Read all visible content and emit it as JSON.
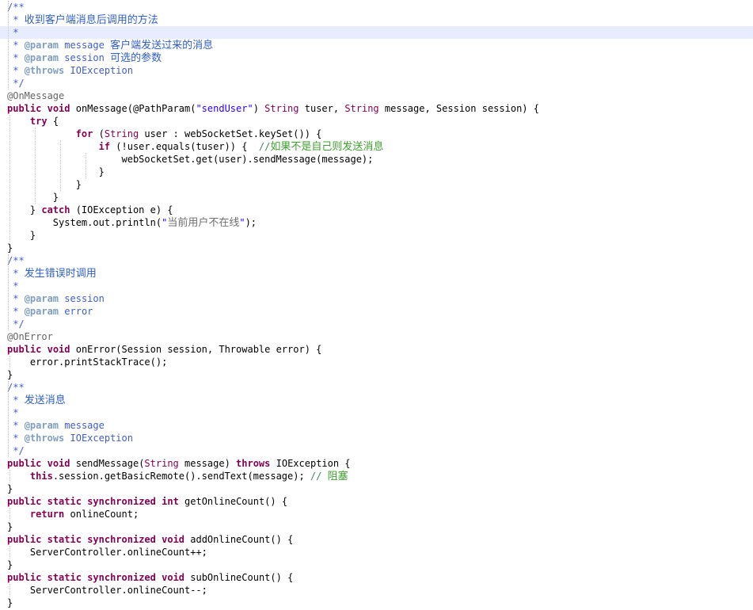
{
  "editor": {
    "lines": [
      [
        {
          "t": "/**",
          "c": "jd"
        }
      ],
      [
        {
          "t": " * ",
          "c": "jd"
        },
        {
          "t": "收到客户端消息后调用的方法",
          "c": "jd",
          "cjk": true
        }
      ],
      [
        {
          "t": " *",
          "c": "jd"
        }
      ],
      [
        {
          "t": " * ",
          "c": "jd"
        },
        {
          "t": "@param",
          "c": "tag"
        },
        {
          "t": " message ",
          "c": "jd"
        },
        {
          "t": "客户端发送过来的消息",
          "c": "jd",
          "cjk": true
        }
      ],
      [
        {
          "t": " * ",
          "c": "jd"
        },
        {
          "t": "@param",
          "c": "tag"
        },
        {
          "t": " session ",
          "c": "jd"
        },
        {
          "t": "可选的参数",
          "c": "jd",
          "cjk": true
        }
      ],
      [
        {
          "t": " * ",
          "c": "jd"
        },
        {
          "t": "@throws",
          "c": "tag"
        },
        {
          "t": " IOException",
          "c": "jd"
        }
      ],
      [
        {
          "t": " */",
          "c": "jd"
        }
      ],
      [
        {
          "t": "@OnMessage",
          "c": "ann"
        }
      ],
      [
        {
          "t": "public",
          "c": "kw"
        },
        {
          "t": " ",
          "c": "pl"
        },
        {
          "t": "void",
          "c": "kw"
        },
        {
          "t": " onMessage(@PathParam(",
          "c": "pl"
        },
        {
          "t": "\"sendUser\"",
          "c": "str"
        },
        {
          "t": ") ",
          "c": "pl"
        },
        {
          "t": "String",
          "c": "ty"
        },
        {
          "t": " tuser, ",
          "c": "pl"
        },
        {
          "t": "String",
          "c": "ty"
        },
        {
          "t": " message, Session session) {",
          "c": "pl"
        }
      ],
      [
        {
          "t": "    ",
          "c": "pl"
        },
        {
          "t": "try",
          "c": "kw"
        },
        {
          "t": " {",
          "c": "pl"
        }
      ],
      [
        {
          "t": "            ",
          "c": "pl"
        },
        {
          "t": "for",
          "c": "kw"
        },
        {
          "t": " (",
          "c": "pl"
        },
        {
          "t": "String",
          "c": "ty"
        },
        {
          "t": " user : webSocketSet.keySet()) {",
          "c": "pl"
        }
      ],
      [
        {
          "t": "                ",
          "c": "pl"
        },
        {
          "t": "if",
          "c": "kw"
        },
        {
          "t": " (!user.equals(tuser)) {  ",
          "c": "pl"
        },
        {
          "t": "//",
          "c": "cm"
        },
        {
          "t": "如果不是自己则发送消息",
          "c": "cm",
          "cjk": true
        }
      ],
      [
        {
          "t": "                    webSocketSet.get(user).sendMessage(message);",
          "c": "pl"
        }
      ],
      [
        {
          "t": "                }",
          "c": "pl"
        }
      ],
      [
        {
          "t": "            }",
          "c": "pl"
        }
      ],
      [
        {
          "t": "        }",
          "c": "pl"
        }
      ],
      [
        {
          "t": "    } ",
          "c": "pl"
        },
        {
          "t": "catch",
          "c": "kw"
        },
        {
          "t": " (IOException e) {",
          "c": "pl"
        }
      ],
      [
        {
          "t": "        System.out.println(",
          "c": "pl"
        },
        {
          "t": "\"",
          "c": "str"
        },
        {
          "t": "当前用户不在线",
          "c": "str",
          "cjk": true
        },
        {
          "t": "\"",
          "c": "str"
        },
        {
          "t": ");",
          "c": "pl"
        }
      ],
      [
        {
          "t": "    }",
          "c": "pl"
        }
      ],
      [
        {
          "t": "}",
          "c": "pl"
        }
      ],
      [
        {
          "t": "/**",
          "c": "jd"
        }
      ],
      [
        {
          "t": " * ",
          "c": "jd"
        },
        {
          "t": "发生错误时调用",
          "c": "jd",
          "cjk": true
        }
      ],
      [
        {
          "t": " *",
          "c": "jd"
        }
      ],
      [
        {
          "t": " * ",
          "c": "jd"
        },
        {
          "t": "@param",
          "c": "tag"
        },
        {
          "t": " session",
          "c": "jd"
        }
      ],
      [
        {
          "t": " * ",
          "c": "jd"
        },
        {
          "t": "@param",
          "c": "tag"
        },
        {
          "t": " error",
          "c": "jd"
        }
      ],
      [
        {
          "t": " */",
          "c": "jd"
        }
      ],
      [
        {
          "t": "@OnError",
          "c": "ann"
        }
      ],
      [
        {
          "t": "public",
          "c": "kw"
        },
        {
          "t": " ",
          "c": "pl"
        },
        {
          "t": "void",
          "c": "kw"
        },
        {
          "t": " onError(Session session, Throwable error) {",
          "c": "pl"
        }
      ],
      [
        {
          "t": "    error.printStackTrace();",
          "c": "pl"
        }
      ],
      [
        {
          "t": "}",
          "c": "pl"
        }
      ],
      [
        {
          "t": "/**",
          "c": "jd"
        }
      ],
      [
        {
          "t": " * ",
          "c": "jd"
        },
        {
          "t": "发送消息",
          "c": "jd",
          "cjk": true
        }
      ],
      [
        {
          "t": " *",
          "c": "jd"
        }
      ],
      [
        {
          "t": " * ",
          "c": "jd"
        },
        {
          "t": "@param",
          "c": "tag"
        },
        {
          "t": " message",
          "c": "jd"
        }
      ],
      [
        {
          "t": " * ",
          "c": "jd"
        },
        {
          "t": "@throws",
          "c": "tag"
        },
        {
          "t": " IOException",
          "c": "jd"
        }
      ],
      [
        {
          "t": " */",
          "c": "jd"
        }
      ],
      [
        {
          "t": "public",
          "c": "kw"
        },
        {
          "t": " ",
          "c": "pl"
        },
        {
          "t": "void",
          "c": "kw"
        },
        {
          "t": " sendMessage(",
          "c": "pl"
        },
        {
          "t": "String",
          "c": "ty"
        },
        {
          "t": " message) ",
          "c": "pl"
        },
        {
          "t": "throws",
          "c": "kw"
        },
        {
          "t": " IOException {",
          "c": "pl"
        }
      ],
      [
        {
          "t": "    ",
          "c": "pl"
        },
        {
          "t": "this",
          "c": "kw"
        },
        {
          "t": ".session.getBasicRemote().sendText(message); ",
          "c": "pl"
        },
        {
          "t": "// ",
          "c": "cm"
        },
        {
          "t": "阻塞",
          "c": "cm",
          "cjk": true
        }
      ],
      [
        {
          "t": "}",
          "c": "pl"
        }
      ],
      [
        {
          "t": "public",
          "c": "kw"
        },
        {
          "t": " ",
          "c": "pl"
        },
        {
          "t": "static",
          "c": "kw"
        },
        {
          "t": " ",
          "c": "pl"
        },
        {
          "t": "synchronized",
          "c": "kw"
        },
        {
          "t": " ",
          "c": "pl"
        },
        {
          "t": "int",
          "c": "kw"
        },
        {
          "t": " getOnlineCount() {",
          "c": "pl"
        }
      ],
      [
        {
          "t": "    ",
          "c": "pl"
        },
        {
          "t": "return",
          "c": "kw"
        },
        {
          "t": " onlineCount;",
          "c": "pl"
        }
      ],
      [
        {
          "t": "}",
          "c": "pl"
        }
      ],
      [
        {
          "t": "public",
          "c": "kw"
        },
        {
          "t": " ",
          "c": "pl"
        },
        {
          "t": "static",
          "c": "kw"
        },
        {
          "t": " ",
          "c": "pl"
        },
        {
          "t": "synchronized",
          "c": "kw"
        },
        {
          "t": " ",
          "c": "pl"
        },
        {
          "t": "void",
          "c": "kw"
        },
        {
          "t": " addOnlineCount() {",
          "c": "pl"
        }
      ],
      [
        {
          "t": "    ServerController.onlineCount++;",
          "c": "pl"
        }
      ],
      [
        {
          "t": "}",
          "c": "pl"
        }
      ],
      [
        {
          "t": "public",
          "c": "kw"
        },
        {
          "t": " ",
          "c": "pl"
        },
        {
          "t": "static",
          "c": "kw"
        },
        {
          "t": " ",
          "c": "pl"
        },
        {
          "t": "synchronized",
          "c": "kw"
        },
        {
          "t": " ",
          "c": "pl"
        },
        {
          "t": "void",
          "c": "kw"
        },
        {
          "t": " subOnlineCount() {",
          "c": "pl"
        }
      ],
      [
        {
          "t": "    ServerController.onlineCount--;",
          "c": "pl"
        }
      ],
      [
        {
          "t": "}",
          "c": "pl"
        }
      ]
    ],
    "highlighted_line": 3
  },
  "colors": {
    "keyword": "#7f0055",
    "javadoc": "#3f5fbf",
    "javadoc_tag": "#7f9fbf",
    "comment": "#3f7f5f",
    "string": "#2a00ff",
    "annotation": "#646464",
    "current_line": "#e8ecff"
  }
}
